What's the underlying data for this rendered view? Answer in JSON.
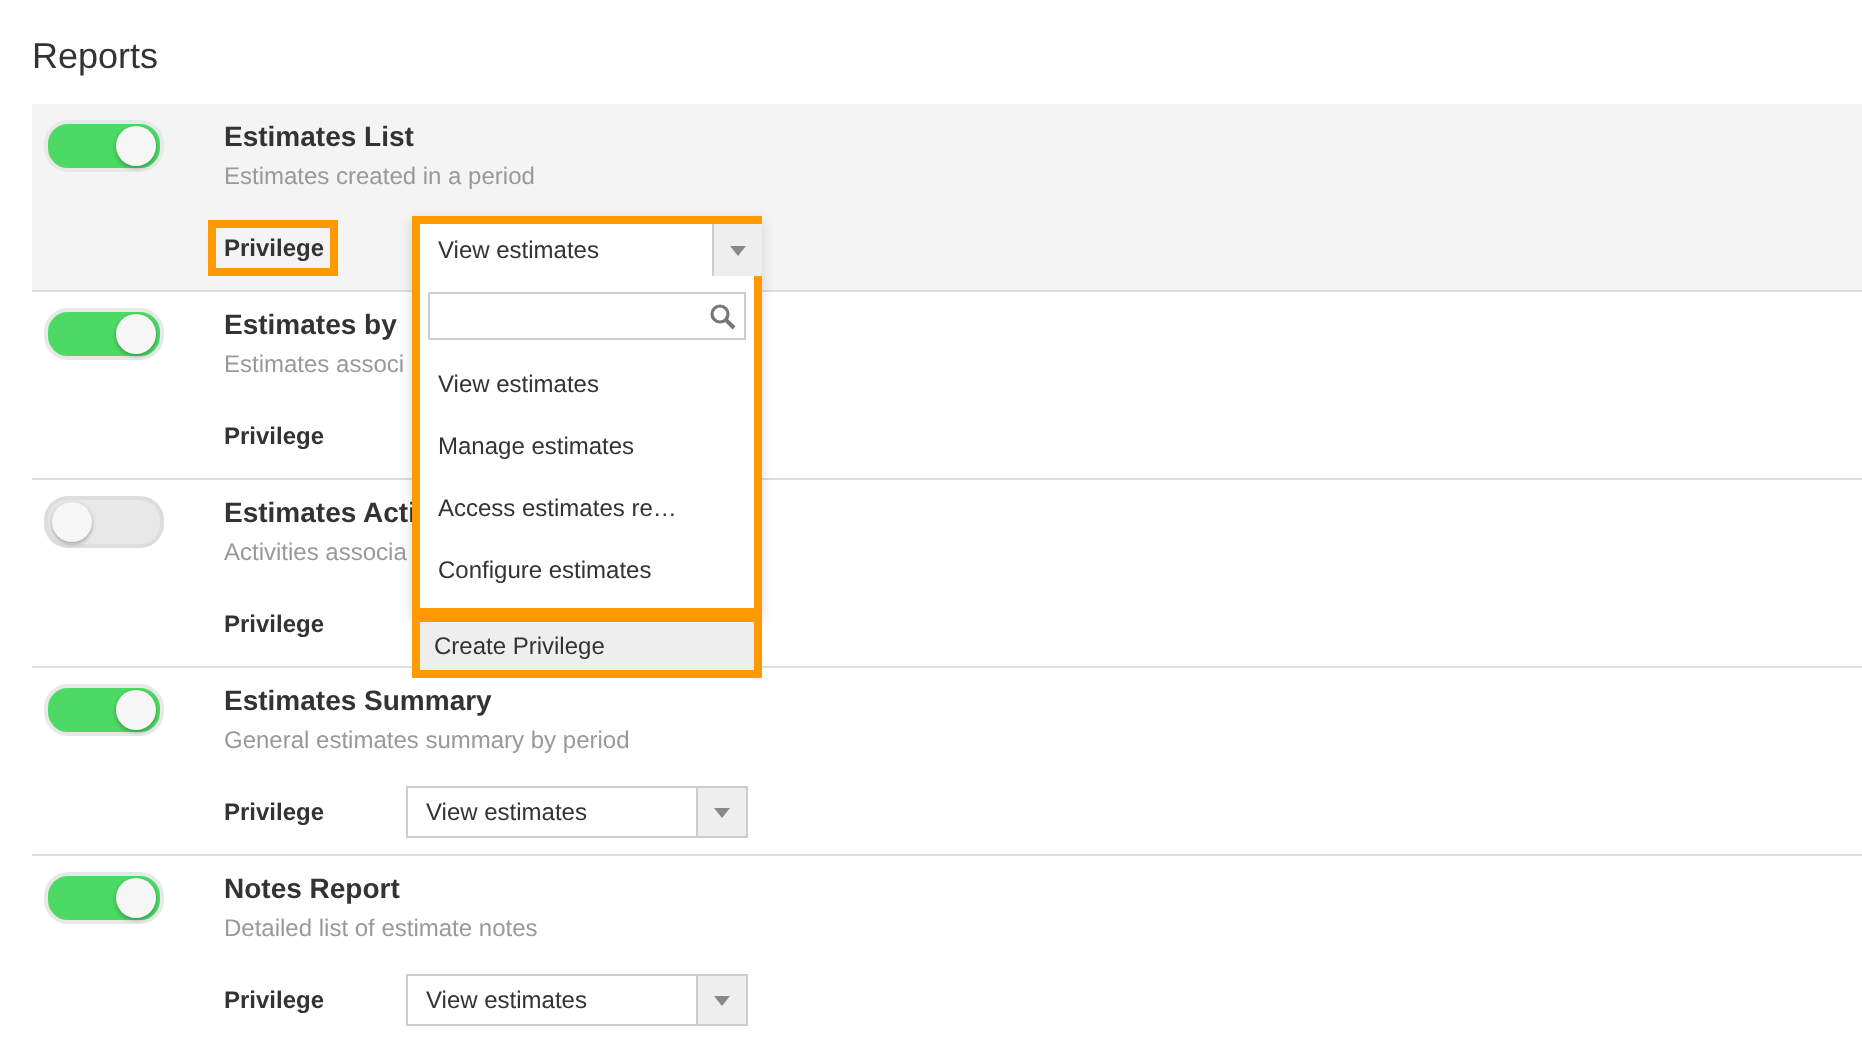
{
  "page_title": "Reports",
  "reports": [
    {
      "title": "Estimates List",
      "description": "Estimates created in a period",
      "enabled": true,
      "privilege_label": "Privilege",
      "label_highlighted": true,
      "select": {
        "value": "View estimates",
        "open": true
      }
    },
    {
      "title": "Estimates by",
      "description": "Estimates associ",
      "enabled": true,
      "privilege_label": "Privilege",
      "label_highlighted": false
    },
    {
      "title": "Estimates Acti",
      "description": "Activities associa",
      "enabled": false,
      "privilege_label": "Privilege",
      "label_highlighted": false
    },
    {
      "title": "Estimates Summary",
      "description": "General estimates summary by period",
      "enabled": true,
      "privilege_label": "Privilege",
      "label_highlighted": false,
      "select": {
        "value": "View estimates",
        "open": false
      }
    },
    {
      "title": "Notes Report",
      "description": "Detailed list of estimate notes",
      "enabled": true,
      "privilege_label": "Privilege",
      "label_highlighted": false,
      "select": {
        "value": "View estimates",
        "open": false
      }
    }
  ],
  "dropdown": {
    "options": [
      "View estimates",
      "Manage estimates",
      "Access estimates re…",
      "Configure estimates"
    ],
    "action": "Create Privilege"
  }
}
